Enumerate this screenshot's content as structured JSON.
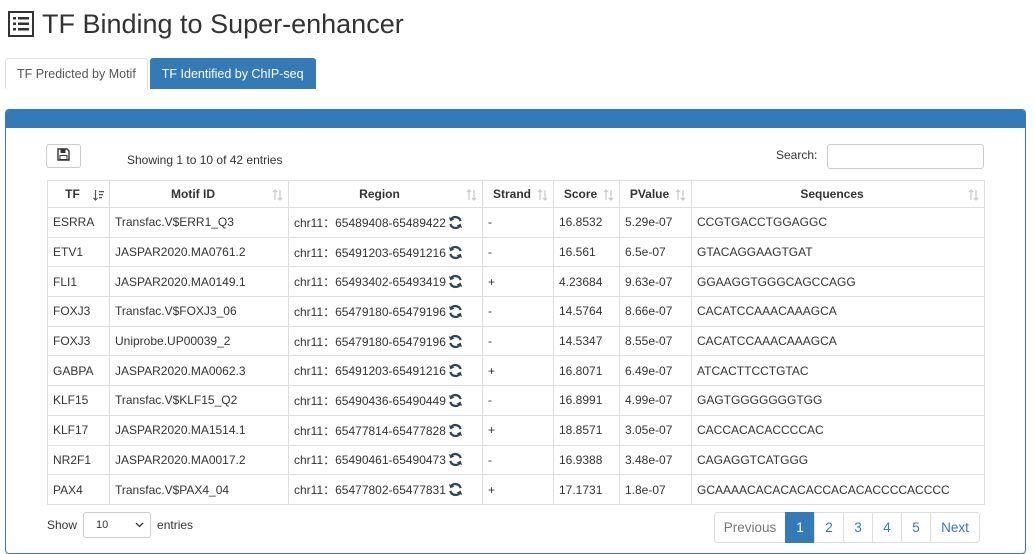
{
  "page": {
    "title": "TF Binding to Super-enhancer",
    "icon": "list-icon"
  },
  "tabs": [
    {
      "label": "TF Predicted by Motif",
      "active": false
    },
    {
      "label": "TF Identified by ChIP-seq",
      "active": true
    }
  ],
  "colors": {
    "accent": "#337ab7",
    "border": "#dddddd",
    "text": "#333333"
  },
  "toolbar": {
    "info": "Showing 1 to 10 of 42 entries",
    "search_label": "Search:",
    "search_value": "",
    "save_icon": "floppy-disk-icon"
  },
  "table": {
    "columns": [
      "TF",
      "Motif ID",
      "Region",
      "Strand",
      "Score",
      "PValue",
      "Sequences"
    ],
    "rows": [
      {
        "tf": "ESRRA",
        "motif": "Transfac.V$ERR1_Q3",
        "region": "chr11：65489408-65489422",
        "strand": "-",
        "score": "16.8532",
        "pvalue": "5.29e-07",
        "seq": "CCGTGACCTGGAGGC"
      },
      {
        "tf": "ETV1",
        "motif": "JASPAR2020.MA0761.2",
        "region": "chr11：65491203-65491216",
        "strand": "-",
        "score": "16.561",
        "pvalue": "6.5e-07",
        "seq": "GTACAGGAAGTGAT"
      },
      {
        "tf": "FLI1",
        "motif": "JASPAR2020.MA0149.1",
        "region": "chr11：65493402-65493419",
        "strand": "+",
        "score": "4.23684",
        "pvalue": "9.63e-07",
        "seq": "GGAAGGTGGGCAGCCAGG"
      },
      {
        "tf": "FOXJ3",
        "motif": "Transfac.V$FOXJ3_06",
        "region": "chr11：65479180-65479196",
        "strand": "-",
        "score": "14.5764",
        "pvalue": "8.66e-07",
        "seq": "CACATCCAAACAAAGCA"
      },
      {
        "tf": "FOXJ3",
        "motif": "Uniprobe.UP00039_2",
        "region": "chr11：65479180-65479196",
        "strand": "-",
        "score": "14.5347",
        "pvalue": "8.55e-07",
        "seq": "CACATCCAAACAAAGCA"
      },
      {
        "tf": "GABPA",
        "motif": "JASPAR2020.MA0062.3",
        "region": "chr11：65491203-65491216",
        "strand": "+",
        "score": "16.8071",
        "pvalue": "6.49e-07",
        "seq": "ATCACTTCCTGTAC"
      },
      {
        "tf": "KLF15",
        "motif": "Transfac.V$KLF15_Q2",
        "region": "chr11：65490436-65490449",
        "strand": "-",
        "score": "16.8991",
        "pvalue": "4.99e-07",
        "seq": "GAGTGGGGGGGTGG"
      },
      {
        "tf": "KLF17",
        "motif": "JASPAR2020.MA1514.1",
        "region": "chr11：65477814-65477828",
        "strand": "+",
        "score": "18.8571",
        "pvalue": "3.05e-07",
        "seq": "CACCACACACCCCAC"
      },
      {
        "tf": "NR2F1",
        "motif": "JASPAR2020.MA0017.2",
        "region": "chr11：65490461-65490473",
        "strand": "-",
        "score": "16.9388",
        "pvalue": "3.48e-07",
        "seq": "CAGAGGTCATGGG"
      },
      {
        "tf": "PAX4",
        "motif": "Transfac.V$PAX4_04",
        "region": "chr11：65477802-65477831",
        "strand": "+",
        "score": "17.1731",
        "pvalue": "1.8e-07",
        "seq": "GCAAAACACACACACCACACACCCCACCCC"
      }
    ]
  },
  "footer": {
    "show_label": "Show",
    "length_value": "10",
    "entries_label": "entries",
    "pagination": {
      "previous": "Previous",
      "pages": [
        "1",
        "2",
        "3",
        "4",
        "5"
      ],
      "current": "1",
      "next": "Next"
    }
  }
}
